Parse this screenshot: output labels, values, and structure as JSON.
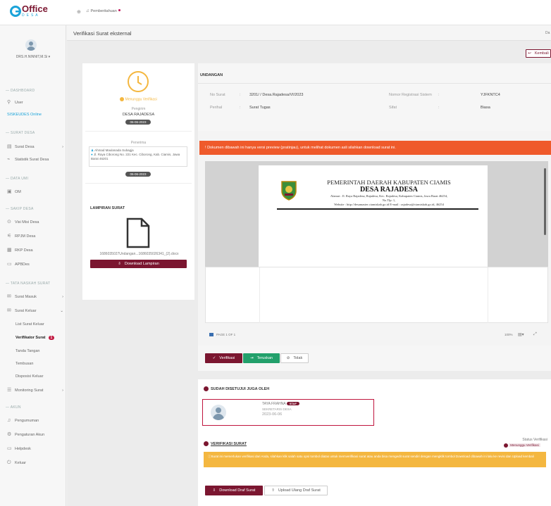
{
  "topbar": {
    "logo_main": "Office",
    "logo_sub": "DESA",
    "notif_label": "Pemberitahuan"
  },
  "sidebar": {
    "user_name": "DRS.H.NINNIT,M.Si",
    "dashboard_section": "DASHBOARD",
    "user_item": "User",
    "siskeudes": "SISKEUDES Online",
    "surat_desa_section": "SURAT DESA",
    "surat_desa": "Surat Desa",
    "statistik": "Statistik Surat Desa",
    "data_umi_section": "DATA UMI",
    "om": "OM",
    "sakip_section": "SAKIP DESA",
    "visi": "Visi Misi Desa",
    "rpjm": "RPJM Desa",
    "rkp": "RKP Desa",
    "apbdes": "APBDes",
    "tata_section": "TATA NASKAH SURAT",
    "surat_masuk": "Surat Masuk",
    "surat_keluar": "Surat Keluar",
    "list_surat_keluar": "List Surat Keluar",
    "verifikator": "Verifikator Surat",
    "verifikator_badge": "1",
    "tanda_tangan": "Tanda Tangan",
    "tembusan": "Tembusan",
    "disposisi": "Disposisi Keluar",
    "monitoring": "Monitoring Surat",
    "akun_section": "AKUN",
    "pengumuman": "Pengumuman",
    "pengaturan": "Pengaturan Akun",
    "helpdesk": "Helpdesk",
    "keluar": "Keluar"
  },
  "page": {
    "title": "Verifikasi Surat eksternal",
    "right_cut": "Da",
    "back_button": "Kembali"
  },
  "status_card": {
    "status": "Menunggu Verifikasi",
    "pengirim_label": "Pengirim",
    "pengirim": "DESA RAJADESA",
    "date1": "06-06-2023",
    "penerima_label": "Penerima",
    "penerima_name": "Ahmad Maulanada Subagja",
    "penerima_addr": "Jl. Raya Ciborong No. 221 Kec. Ciborong, Kab. Ciamis, Jawa Barat 46201",
    "date2": "06-06-2023"
  },
  "lampiran": {
    "title": "LAMPIRAN SURAT",
    "filename": "1686035027Undangan...1686035026341_(2).docx",
    "download": "Download Lampiran"
  },
  "undangan": {
    "title": "UNDANGAN",
    "no_surat_label": "No Surat",
    "no_surat": "3201/ / Desa.Rajadesa/VI/2023",
    "reg_label": "Nomor Registrasi Sistem",
    "reg": "YJFKNTC4",
    "perihal_label": "Perihal",
    "perihal": "Surat Tugas",
    "sifat_label": "Sifat",
    "sifat": "Biasa"
  },
  "alert": {
    "text": "Dokumen dibawah ini hanya versi preview (pratinjau), untuk melihat dokumen asli silahkan download surat ini."
  },
  "letter": {
    "line1": "PEMERINTAH DAERAH KABUPATEN CIAMIS",
    "line2": "DESA RAJADESA",
    "line3": "Alamat : Jl. Raya Rajadesa, Rajadesa, Kec. Rajadesa, Kabupaten Ciamis, Jawa Barat 46254,",
    "line4": "No.Tlp: 1,",
    "line5": "Website : http://desamaster.ciamiskab.go.id  E-mail : rajadesa@ciamiskab.go.id, 46254"
  },
  "viewer": {
    "page_label": "PAGE 1 OF 1",
    "zoom": "100%"
  },
  "actions": {
    "verifikasi": "Verifikasi",
    "teruskan": "Teruskan",
    "tolak": "Tolak"
  },
  "approved": {
    "title": "SUDAH DISETUJUI JUGA OLEH",
    "name": "TAYA FRAHNA",
    "badge": "STAF",
    "role": "SEKRETARIS DESA",
    "date": "2023-06-06"
  },
  "verif": {
    "title": "VERIFIKASI SURAT",
    "status_label": "Status Verifikasi",
    "status": "Menunggu Verifikasi",
    "notice": "Surat ini memerlukan verifikasi dari Anda, silahkan klik salah satu opsi tombol diatas untuk memverifikasi surat atau anda bisa mengedit surat sendiri dengan mengklik tombol Download dibawah ini lalu ke revisi dan Upload kembali",
    "download_draf": "Download Draf Surat",
    "upload_draf": "Upload Ulang Draf Surat"
  },
  "colors": {
    "maroon": "#7b1630",
    "orange": "#ef5a2b",
    "green": "#22a06b",
    "yellow": "#f4b740",
    "accent_blue": "#1aa3d9"
  }
}
